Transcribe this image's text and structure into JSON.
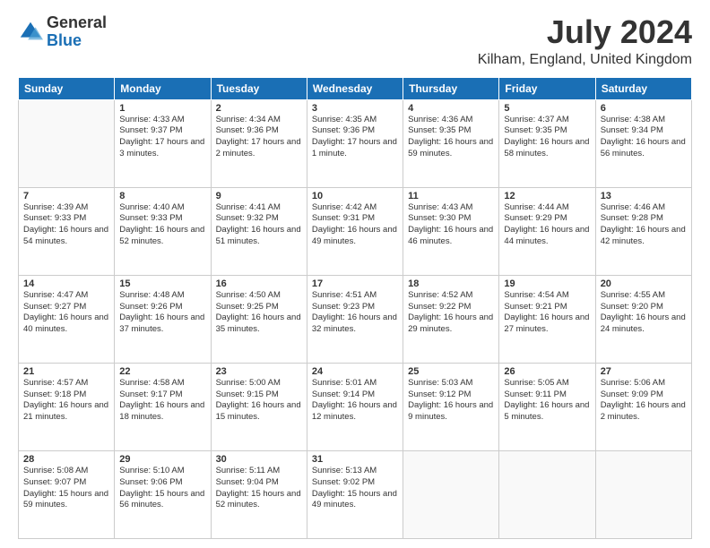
{
  "logo": {
    "general": "General",
    "blue": "Blue"
  },
  "title": "July 2024",
  "subtitle": "Kilham, England, United Kingdom",
  "weekdays": [
    "Sunday",
    "Monday",
    "Tuesday",
    "Wednesday",
    "Thursday",
    "Friday",
    "Saturday"
  ],
  "weeks": [
    [
      {
        "day": "",
        "sunrise": "",
        "sunset": "",
        "daylight": ""
      },
      {
        "day": "1",
        "sunrise": "Sunrise: 4:33 AM",
        "sunset": "Sunset: 9:37 PM",
        "daylight": "Daylight: 17 hours and 3 minutes."
      },
      {
        "day": "2",
        "sunrise": "Sunrise: 4:34 AM",
        "sunset": "Sunset: 9:36 PM",
        "daylight": "Daylight: 17 hours and 2 minutes."
      },
      {
        "day": "3",
        "sunrise": "Sunrise: 4:35 AM",
        "sunset": "Sunset: 9:36 PM",
        "daylight": "Daylight: 17 hours and 1 minute."
      },
      {
        "day": "4",
        "sunrise": "Sunrise: 4:36 AM",
        "sunset": "Sunset: 9:35 PM",
        "daylight": "Daylight: 16 hours and 59 minutes."
      },
      {
        "day": "5",
        "sunrise": "Sunrise: 4:37 AM",
        "sunset": "Sunset: 9:35 PM",
        "daylight": "Daylight: 16 hours and 58 minutes."
      },
      {
        "day": "6",
        "sunrise": "Sunrise: 4:38 AM",
        "sunset": "Sunset: 9:34 PM",
        "daylight": "Daylight: 16 hours and 56 minutes."
      }
    ],
    [
      {
        "day": "7",
        "sunrise": "Sunrise: 4:39 AM",
        "sunset": "Sunset: 9:33 PM",
        "daylight": "Daylight: 16 hours and 54 minutes."
      },
      {
        "day": "8",
        "sunrise": "Sunrise: 4:40 AM",
        "sunset": "Sunset: 9:33 PM",
        "daylight": "Daylight: 16 hours and 52 minutes."
      },
      {
        "day": "9",
        "sunrise": "Sunrise: 4:41 AM",
        "sunset": "Sunset: 9:32 PM",
        "daylight": "Daylight: 16 hours and 51 minutes."
      },
      {
        "day": "10",
        "sunrise": "Sunrise: 4:42 AM",
        "sunset": "Sunset: 9:31 PM",
        "daylight": "Daylight: 16 hours and 49 minutes."
      },
      {
        "day": "11",
        "sunrise": "Sunrise: 4:43 AM",
        "sunset": "Sunset: 9:30 PM",
        "daylight": "Daylight: 16 hours and 46 minutes."
      },
      {
        "day": "12",
        "sunrise": "Sunrise: 4:44 AM",
        "sunset": "Sunset: 9:29 PM",
        "daylight": "Daylight: 16 hours and 44 minutes."
      },
      {
        "day": "13",
        "sunrise": "Sunrise: 4:46 AM",
        "sunset": "Sunset: 9:28 PM",
        "daylight": "Daylight: 16 hours and 42 minutes."
      }
    ],
    [
      {
        "day": "14",
        "sunrise": "Sunrise: 4:47 AM",
        "sunset": "Sunset: 9:27 PM",
        "daylight": "Daylight: 16 hours and 40 minutes."
      },
      {
        "day": "15",
        "sunrise": "Sunrise: 4:48 AM",
        "sunset": "Sunset: 9:26 PM",
        "daylight": "Daylight: 16 hours and 37 minutes."
      },
      {
        "day": "16",
        "sunrise": "Sunrise: 4:50 AM",
        "sunset": "Sunset: 9:25 PM",
        "daylight": "Daylight: 16 hours and 35 minutes."
      },
      {
        "day": "17",
        "sunrise": "Sunrise: 4:51 AM",
        "sunset": "Sunset: 9:23 PM",
        "daylight": "Daylight: 16 hours and 32 minutes."
      },
      {
        "day": "18",
        "sunrise": "Sunrise: 4:52 AM",
        "sunset": "Sunset: 9:22 PM",
        "daylight": "Daylight: 16 hours and 29 minutes."
      },
      {
        "day": "19",
        "sunrise": "Sunrise: 4:54 AM",
        "sunset": "Sunset: 9:21 PM",
        "daylight": "Daylight: 16 hours and 27 minutes."
      },
      {
        "day": "20",
        "sunrise": "Sunrise: 4:55 AM",
        "sunset": "Sunset: 9:20 PM",
        "daylight": "Daylight: 16 hours and 24 minutes."
      }
    ],
    [
      {
        "day": "21",
        "sunrise": "Sunrise: 4:57 AM",
        "sunset": "Sunset: 9:18 PM",
        "daylight": "Daylight: 16 hours and 21 minutes."
      },
      {
        "day": "22",
        "sunrise": "Sunrise: 4:58 AM",
        "sunset": "Sunset: 9:17 PM",
        "daylight": "Daylight: 16 hours and 18 minutes."
      },
      {
        "day": "23",
        "sunrise": "Sunrise: 5:00 AM",
        "sunset": "Sunset: 9:15 PM",
        "daylight": "Daylight: 16 hours and 15 minutes."
      },
      {
        "day": "24",
        "sunrise": "Sunrise: 5:01 AM",
        "sunset": "Sunset: 9:14 PM",
        "daylight": "Daylight: 16 hours and 12 minutes."
      },
      {
        "day": "25",
        "sunrise": "Sunrise: 5:03 AM",
        "sunset": "Sunset: 9:12 PM",
        "daylight": "Daylight: 16 hours and 9 minutes."
      },
      {
        "day": "26",
        "sunrise": "Sunrise: 5:05 AM",
        "sunset": "Sunset: 9:11 PM",
        "daylight": "Daylight: 16 hours and 5 minutes."
      },
      {
        "day": "27",
        "sunrise": "Sunrise: 5:06 AM",
        "sunset": "Sunset: 9:09 PM",
        "daylight": "Daylight: 16 hours and 2 minutes."
      }
    ],
    [
      {
        "day": "28",
        "sunrise": "Sunrise: 5:08 AM",
        "sunset": "Sunset: 9:07 PM",
        "daylight": "Daylight: 15 hours and 59 minutes."
      },
      {
        "day": "29",
        "sunrise": "Sunrise: 5:10 AM",
        "sunset": "Sunset: 9:06 PM",
        "daylight": "Daylight: 15 hours and 56 minutes."
      },
      {
        "day": "30",
        "sunrise": "Sunrise: 5:11 AM",
        "sunset": "Sunset: 9:04 PM",
        "daylight": "Daylight: 15 hours and 52 minutes."
      },
      {
        "day": "31",
        "sunrise": "Sunrise: 5:13 AM",
        "sunset": "Sunset: 9:02 PM",
        "daylight": "Daylight: 15 hours and 49 minutes."
      },
      {
        "day": "",
        "sunrise": "",
        "sunset": "",
        "daylight": ""
      },
      {
        "day": "",
        "sunrise": "",
        "sunset": "",
        "daylight": ""
      },
      {
        "day": "",
        "sunrise": "",
        "sunset": "",
        "daylight": ""
      }
    ]
  ]
}
